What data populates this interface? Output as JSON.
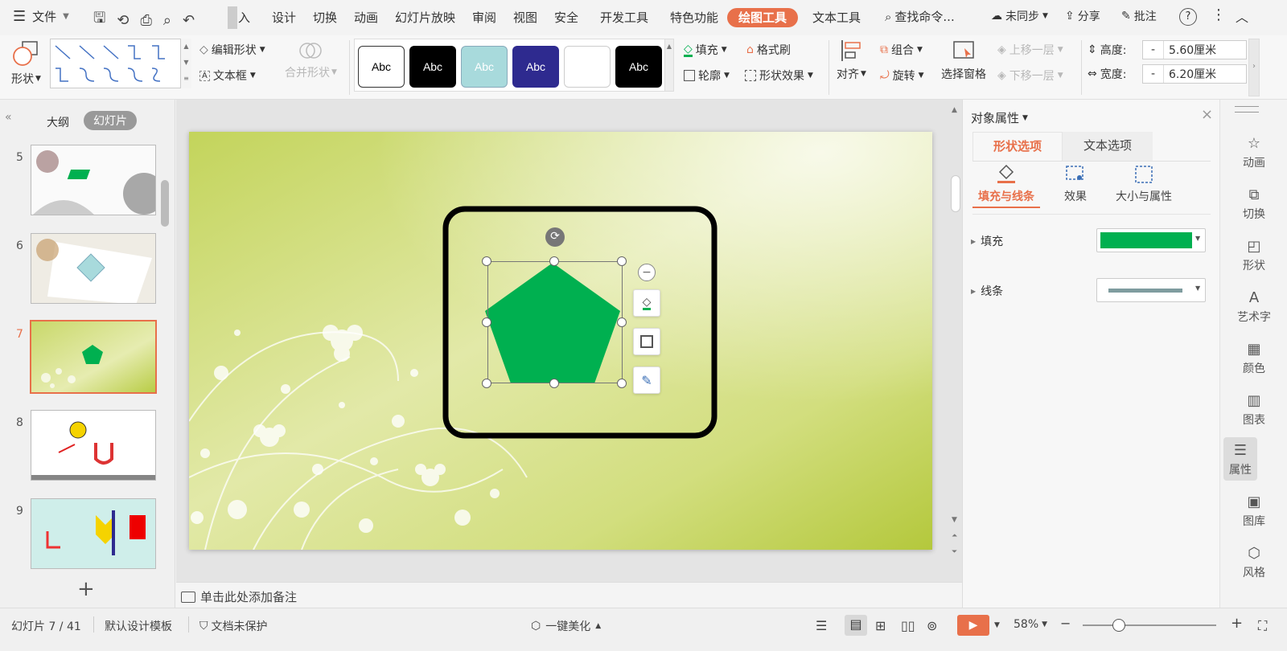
{
  "menubar": {
    "file": "文件",
    "tabs": [
      "插入",
      "设计",
      "切换",
      "动画",
      "幻灯片放映",
      "审阅",
      "视图",
      "安全",
      "开发工具",
      "特色功能",
      "绘图工具",
      "文本工具"
    ],
    "insert_partial": "入",
    "search": "查找命令...",
    "sync": "未同步",
    "share": "分享",
    "comment": "批注",
    "help": "?"
  },
  "ribbon": {
    "shape": "形状",
    "edit_shape": "编辑形状",
    "textbox": "文本框",
    "merge_shape": "合并形状",
    "style_label": "Abc",
    "fill": "填充",
    "format_painter": "格式刷",
    "outline": "轮廓",
    "shape_effect": "形状效果",
    "align": "对齐",
    "group": "组合",
    "rotate": "旋转",
    "select_pane": "选择窗格",
    "bring_forward": "上移一层",
    "send_backward": "下移一层",
    "height_label": "高度:",
    "height_value": "5.60厘米",
    "width_label": "宽度:",
    "width_value": "6.20厘米",
    "minus": "-"
  },
  "leftpanel": {
    "outline_tab": "大纲",
    "slides_tab": "幻灯片",
    "slide_numbers": [
      "5",
      "6",
      "7",
      "8",
      "9"
    ],
    "add": "+"
  },
  "notes": {
    "placeholder": "单击此处添加备注"
  },
  "rightpanel": {
    "title": "对象属性",
    "tab_shape": "形状选项",
    "tab_text": "文本选项",
    "sub_fill_line": "填充与线条",
    "sub_effect": "效果",
    "sub_size": "大小与属性",
    "fill_label": "填充",
    "line_label": "线条",
    "fill_color": "#00b050",
    "line_color": "#7f9c9f"
  },
  "sidebar": [
    "动画",
    "切换",
    "形状",
    "艺术字",
    "颜色",
    "图表",
    "属性",
    "图库",
    "风格"
  ],
  "statusbar": {
    "slide_info": "幻灯片 7 / 41",
    "template": "默认设计模板",
    "protect": "文档未保护",
    "beautify": "一键美化",
    "zoom": "58%",
    "zoom_minus": "−",
    "zoom_plus": "+",
    "zoom_fraction": 0.27
  },
  "colors": {
    "accent": "#e8704a",
    "pentagon": "#00b050"
  }
}
